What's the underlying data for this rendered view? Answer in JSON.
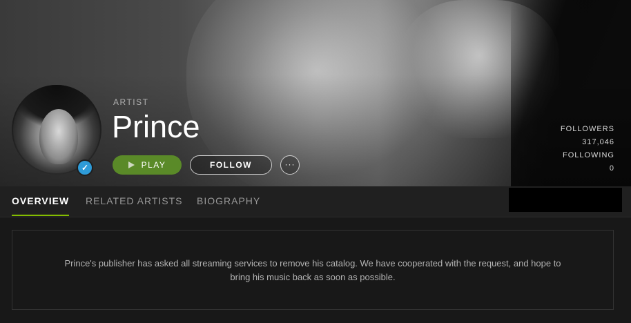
{
  "artist": {
    "type_label": "ARTIST",
    "name": "Prince",
    "verified": true
  },
  "actions": {
    "play_label": "PLAY",
    "follow_label": "FOLLOW",
    "more_label": "···"
  },
  "stats": {
    "followers_label": "FOLLOWERS",
    "followers_value": "317,046",
    "following_label": "FOLLOWING",
    "following_value": "0"
  },
  "tabs": [
    {
      "label": "OVERVIEW",
      "active": true
    },
    {
      "label": "RELATED ARTISTS",
      "active": false
    },
    {
      "label": "BIOGRAPHY",
      "active": false
    }
  ],
  "notice": {
    "text": "Prince's publisher has asked all streaming services to remove his catalog. We have cooperated with the request, and hope to bring his music back as soon as possible."
  },
  "colors": {
    "accent_green": "#84bd00",
    "play_button": "#5a8a28",
    "verified_blue": "#2e9bd8",
    "background": "#181818"
  },
  "icons": {
    "play": "play-icon",
    "verified": "check-icon",
    "more": "ellipsis-icon"
  }
}
